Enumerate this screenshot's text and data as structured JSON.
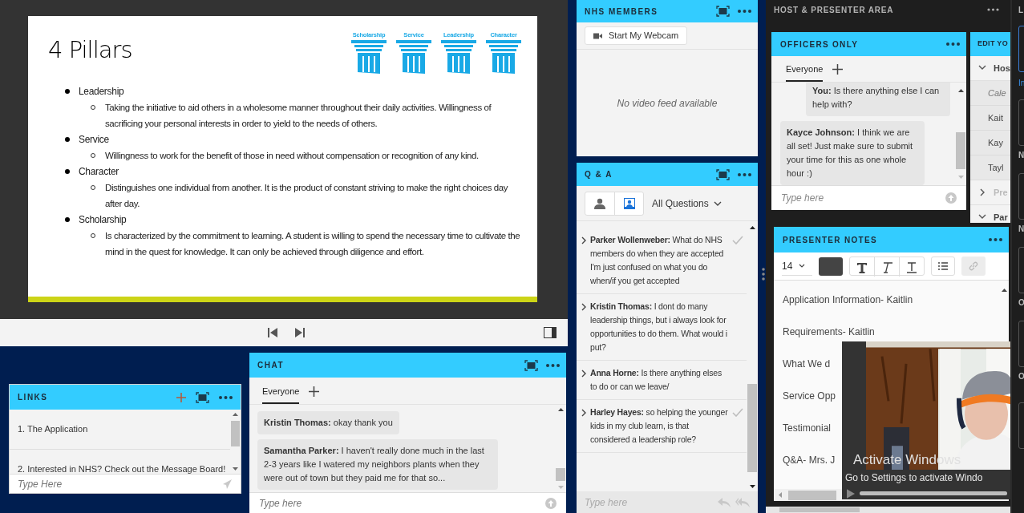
{
  "share_pod": {
    "slide": {
      "title": "4 Pillars",
      "pillars": [
        "Scholarship",
        "Service",
        "Leadership",
        "Character"
      ],
      "bullets": [
        {
          "text": "Leadership",
          "children": [
            {
              "text": "Taking the initiative to aid others in a wholesome manner throughout their daily activities. Willingness of sacrificing your personal interests in order to yield to the needs of others."
            }
          ]
        },
        {
          "text": "Service",
          "children": [
            {
              "text": "Willingness to work for the benefit of those in need without compensation or recognition of any kind."
            }
          ]
        },
        {
          "text": "Character",
          "children": [
            {
              "text": "Distinguishes one individual from another. It is the product of constant striving to make the right choices day after day."
            }
          ]
        },
        {
          "text": "Scholarship",
          "children": [
            {
              "text": "Is characterized by the commitment to learning. A student is willing to spend the necessary time to cultivate the mind in the quest for knowledge. It can only be achieved through diligence and effort."
            }
          ]
        }
      ]
    }
  },
  "links_pod": {
    "title": "LINKS",
    "items": [
      {
        "text": "1. The Application"
      },
      {
        "text": "2. Interested in NHS? Check out the Message Board!"
      }
    ],
    "input": {
      "placeholder": "Type Here"
    }
  },
  "chat_pod": {
    "title": "CHAT",
    "tabs": [
      {
        "label": "Everyone",
        "selected": true
      }
    ],
    "messages": [
      {
        "text": "**Kristin Thomas:** okay thank you"
      },
      {
        "text": "**Samantha Parker:** I haven't really done much in the last 2-3 years like I watered my neighbors plants when they were out of town but they paid me for that so..."
      }
    ],
    "input": {
      "placeholder": "Type here"
    }
  },
  "nhs_members_pod": {
    "title": "NHS MEMBERS",
    "webcam_button": "Start My Webcam",
    "status": "No video feed available"
  },
  "qa_pod": {
    "title": "Q & A",
    "view_toggles": [
      {
        "kind": "person",
        "selected": false
      },
      {
        "kind": "presenter",
        "selected": true
      }
    ],
    "filter": "All Questions",
    "questions": [
      {
        "text": "**Parker Wollenweber:** What do NHS members do when they are accepted I'm just confused on what you do when/if you get accepted",
        "answered": true
      },
      {
        "text": "**Kristin Thomas:** I dont do many leadership things, but i always look for opportunities to do them. What would i put?",
        "answered": false
      },
      {
        "text": "**Anna Horne:** Is there anything elses to do or can we leave/",
        "answered": false
      },
      {
        "text": "**Harley Hayes:** so helping the younger kids in my club learn, is that considered a leadership role?",
        "answered": true
      }
    ],
    "input": {
      "placeholder": "Type here"
    }
  },
  "host_area": {
    "title": "HOST & PRESENTER AREA",
    "officers_pod": {
      "title": "OFFICERS ONLY",
      "tabs": [
        {
          "label": "Everyone",
          "selected": true
        }
      ],
      "messages": [
        {
          "kind": "sent",
          "text": "**You:** Is there anything else I can help with?"
        },
        {
          "kind": "received",
          "text": "**Kayce Johnson:** I think we are all set! Just make sure to submit your time for this as one whole hour :)"
        }
      ],
      "input": {
        "placeholder": "Type here"
      }
    },
    "edit_pod": {
      "title": "EDIT YO",
      "groups": [
        {
          "label": "Hos",
          "expanded": true,
          "disabled": false,
          "children": [
            {
              "label": "Cale",
              "kind": "placeholder"
            },
            {
              "label": "Kait",
              "kind": "name"
            },
            {
              "label": "Kay",
              "kind": "name"
            },
            {
              "label": "Tayl",
              "kind": "name"
            }
          ]
        },
        {
          "label": "Pre",
          "expanded": false,
          "disabled": true
        },
        {
          "label": "Par",
          "expanded": true,
          "disabled": false
        }
      ]
    },
    "presenter_notes": {
      "title": "PRESENTER NOTES",
      "font_size": "14",
      "link_button": {
        "disabled": true
      },
      "lines": [
        "Application Information- Kaitlin",
        "Requirements- Kaitlin",
        "What We d",
        "Service Opp",
        "Testimonial",
        "Q&A- Mrs. J"
      ]
    },
    "side_panel": {
      "title": "L",
      "link": "In",
      "labels": [
        "N",
        "N",
        "O",
        "O"
      ]
    }
  },
  "video_player": {
    "level": 1
  },
  "os_notice": {
    "title": "Activate Windows",
    "subtitle": "Go to Settings to activate Windo"
  }
}
